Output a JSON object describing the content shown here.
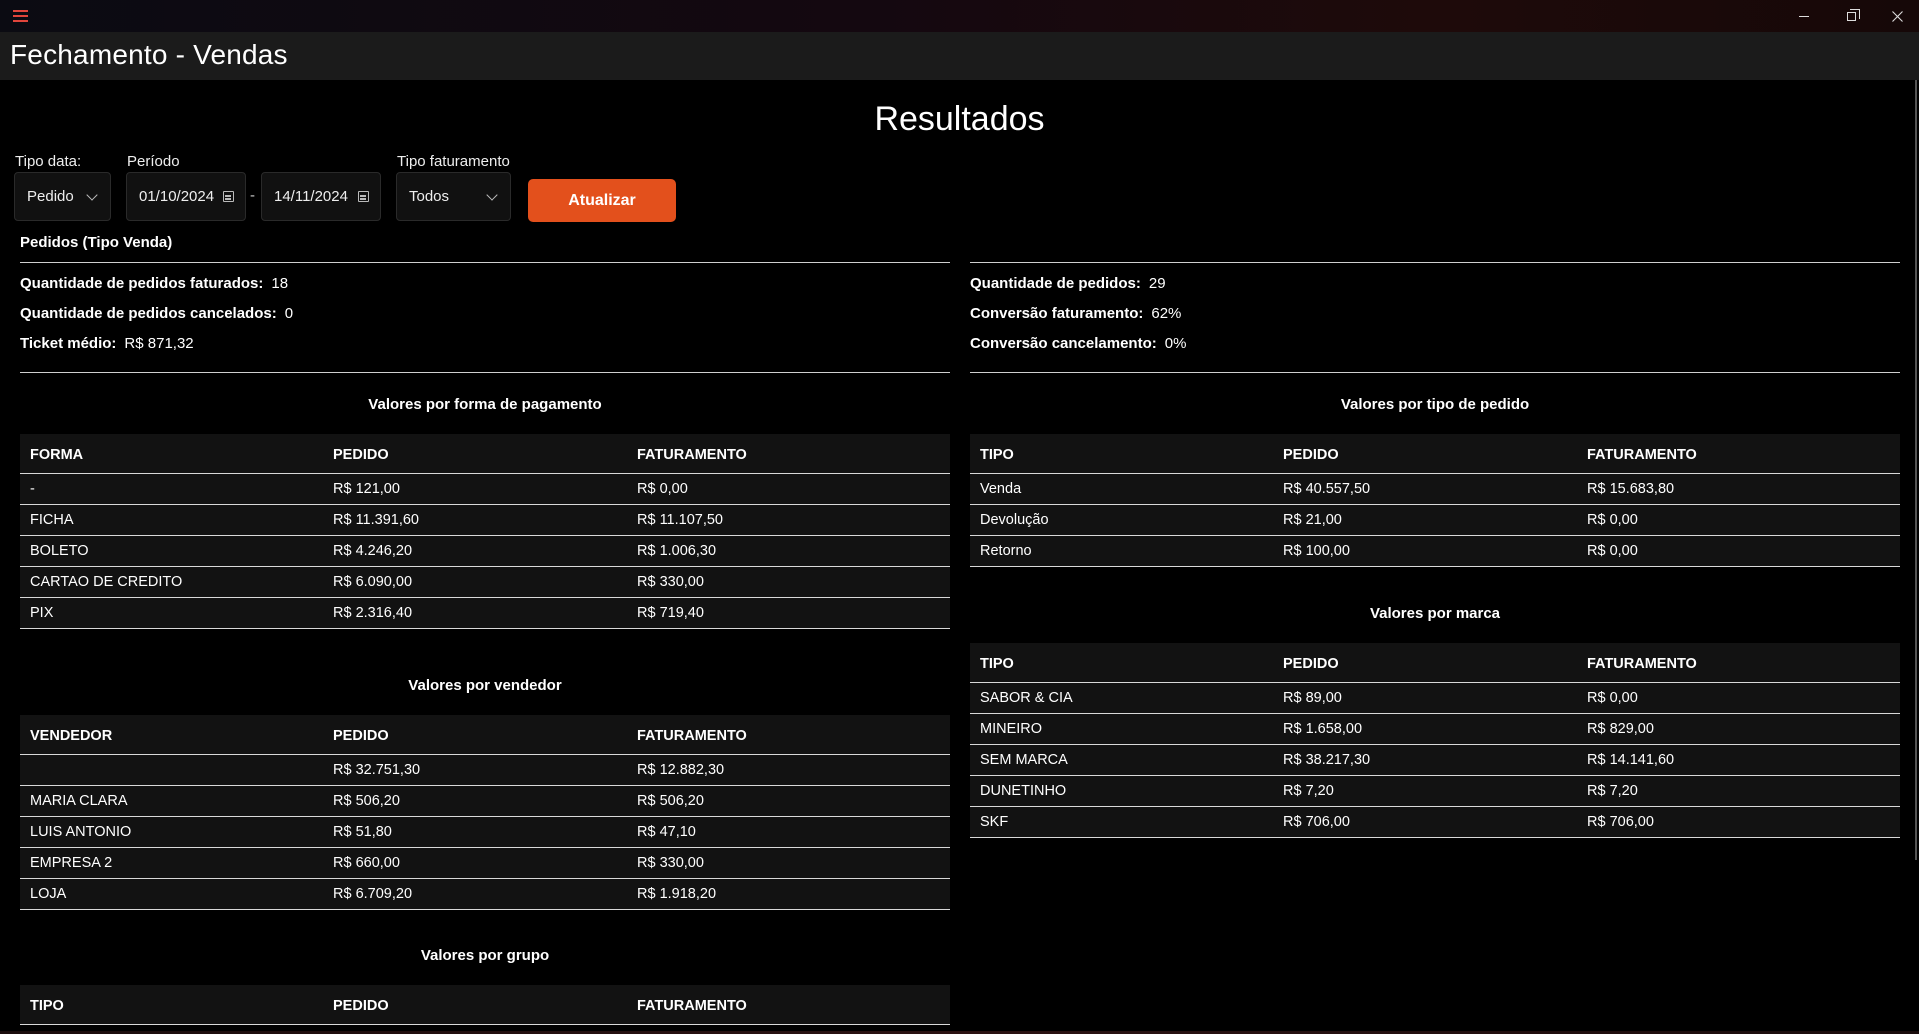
{
  "window": {
    "title": "Fechamento - Vendas"
  },
  "page_title": "Resultados",
  "filters": {
    "tipo_data": {
      "label": "Tipo data:",
      "value": "Pedido"
    },
    "periodo": {
      "label": "Período",
      "start": "01/10/2024",
      "separator": "-",
      "end": "14/11/2024"
    },
    "tipo_faturamento": {
      "label": "Tipo faturamento",
      "value": "Todos"
    },
    "update_button": "Atualizar"
  },
  "pedidos_section": {
    "heading": "Pedidos (Tipo Venda)"
  },
  "stats_left": [
    {
      "label": "Quantidade de pedidos faturados:",
      "value": "18"
    },
    {
      "label": "Quantidade de pedidos cancelados:",
      "value": "0"
    },
    {
      "label": "Ticket médio:",
      "value": "R$ 871,32"
    }
  ],
  "stats_right": [
    {
      "label": "Quantidade de pedidos:",
      "value": "29"
    },
    {
      "label": "Conversão faturamento:",
      "value": "62%"
    },
    {
      "label": "Conversão cancelamento:",
      "value": "0%"
    }
  ],
  "tables": {
    "pagamento": {
      "title": "Valores por forma de pagamento",
      "headers": [
        "FORMA",
        "PEDIDO",
        "FATURAMENTO"
      ],
      "rows": [
        [
          "-",
          "R$ 121,00",
          "R$ 0,00"
        ],
        [
          "FICHA",
          "R$ 11.391,60",
          "R$ 11.107,50"
        ],
        [
          "BOLETO",
          "R$ 4.246,20",
          "R$ 1.006,30"
        ],
        [
          "CARTAO DE CREDITO",
          "R$ 6.090,00",
          "R$ 330,00"
        ],
        [
          "PIX",
          "R$ 2.316,40",
          "R$ 719,40"
        ]
      ]
    },
    "vendedor": {
      "title": "Valores por vendedor",
      "headers": [
        "VENDEDOR",
        "PEDIDO",
        "FATURAMENTO"
      ],
      "rows": [
        [
          "",
          "R$ 32.751,30",
          "R$ 12.882,30"
        ],
        [
          "MARIA CLARA",
          "R$ 506,20",
          "R$ 506,20"
        ],
        [
          "LUIS ANTONIO",
          "R$ 51,80",
          "R$ 47,10"
        ],
        [
          "EMPRESA 2",
          "R$ 660,00",
          "R$ 330,00"
        ],
        [
          "LOJA",
          "R$ 6.709,20",
          "R$ 1.918,20"
        ]
      ]
    },
    "grupo": {
      "title": "Valores por grupo",
      "headers": [
        "TIPO",
        "PEDIDO",
        "FATURAMENTO"
      ],
      "rows": []
    },
    "tipo_pedido": {
      "title": "Valores por tipo de pedido",
      "headers": [
        "TIPO",
        "PEDIDO",
        "FATURAMENTO"
      ],
      "rows": [
        [
          "Venda",
          "R$ 40.557,50",
          "R$ 15.683,80"
        ],
        [
          "Devolução",
          "R$ 21,00",
          "R$ 0,00"
        ],
        [
          "Retorno",
          "R$ 100,00",
          "R$ 0,00"
        ]
      ]
    },
    "marca": {
      "title": "Valores por marca",
      "headers": [
        "TIPO",
        "PEDIDO",
        "FATURAMENTO"
      ],
      "rows": [
        [
          "SABOR & CIA",
          "R$ 89,00",
          "R$ 0,00"
        ],
        [
          "MINEIRO",
          "R$ 1.658,00",
          "R$ 829,00"
        ],
        [
          "SEM MARCA",
          "R$ 38.217,30",
          "R$ 14.141,60"
        ],
        [
          "DUNETINHO",
          "R$ 7,20",
          "R$ 7,20"
        ],
        [
          "SKF",
          "R$ 706,00",
          "R$ 706,00"
        ]
      ]
    }
  }
}
